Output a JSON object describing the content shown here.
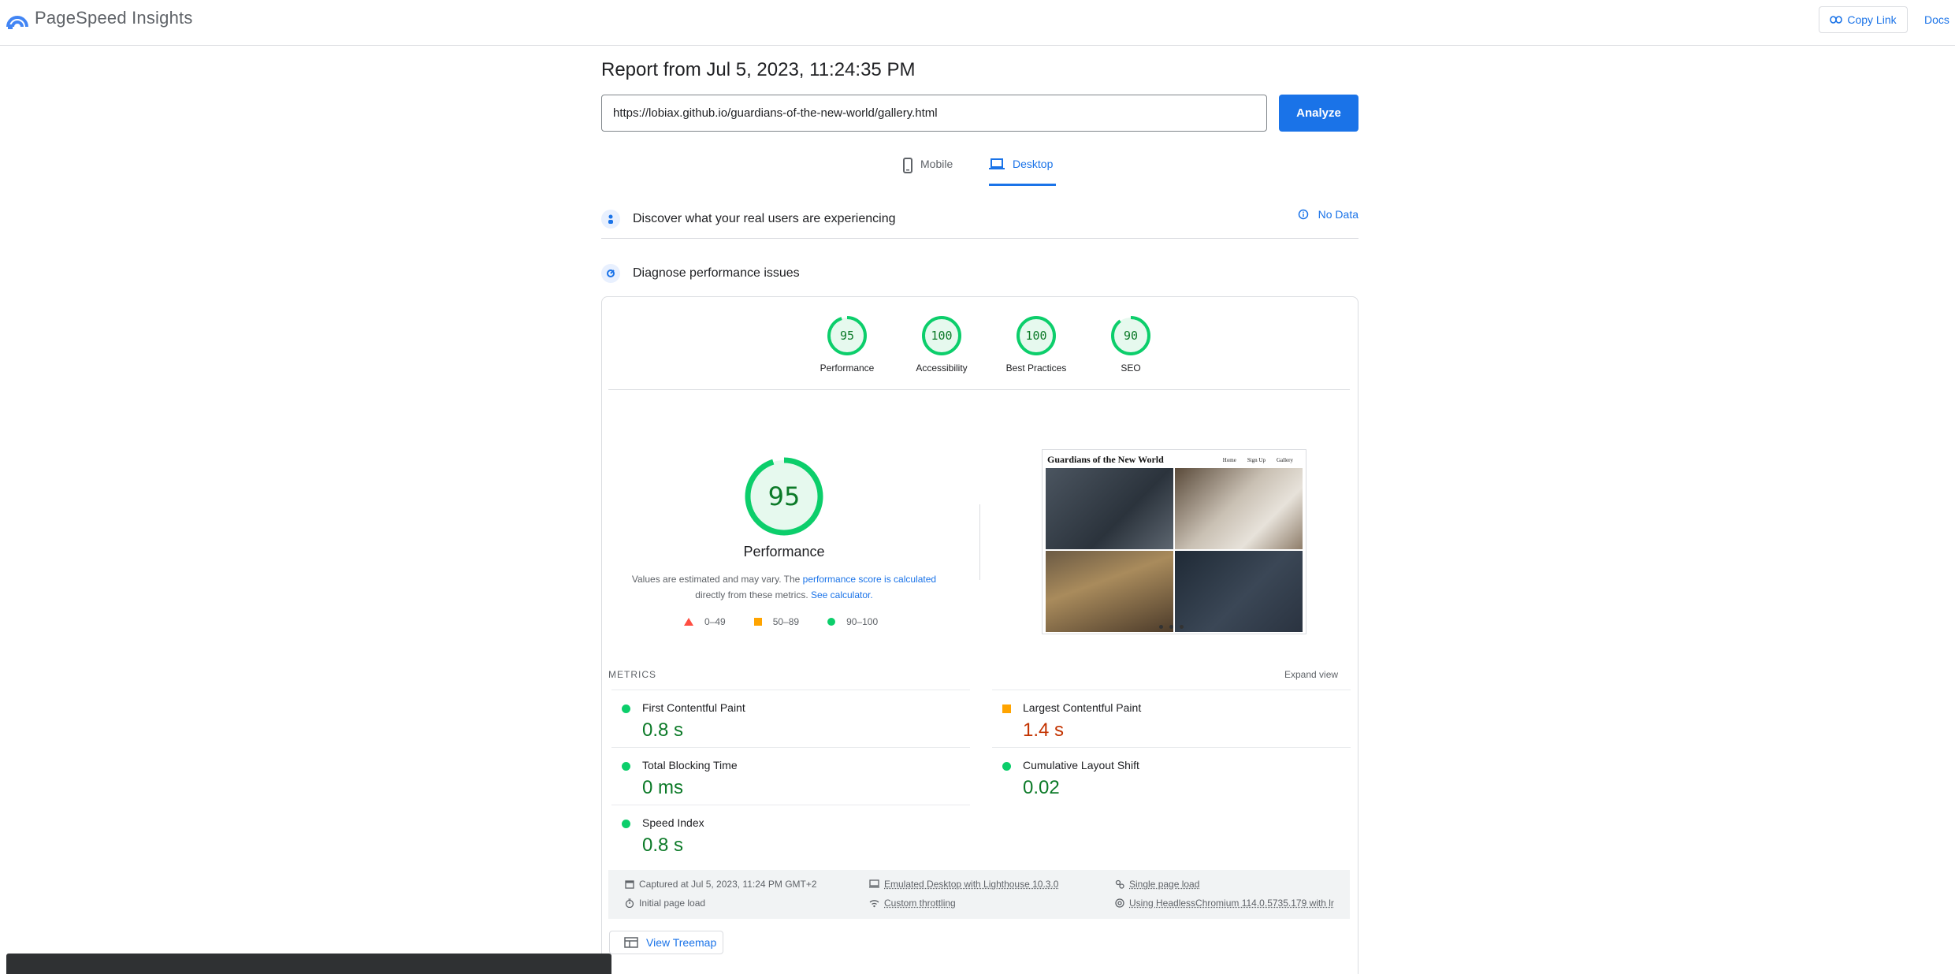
{
  "header": {
    "brand": "PageSpeed Insights",
    "copy_link": "Copy Link",
    "docs": "Docs"
  },
  "report": {
    "title": "Report from Jul 5, 2023, 11:24:35 PM",
    "url": "https://lobiax.github.io/guardians-of-the-new-world/gallery.html",
    "analyze_label": "Analyze"
  },
  "tabs": [
    {
      "label": "Mobile",
      "selected": false
    },
    {
      "label": "Desktop",
      "selected": true
    }
  ],
  "sections": {
    "discover": "Discover what your real users are experiencing",
    "no_data": "No Data",
    "diagnose": "Diagnose performance issues"
  },
  "scores": [
    {
      "label": "Performance",
      "value": "95"
    },
    {
      "label": "Accessibility",
      "value": "100"
    },
    {
      "label": "Best Practices",
      "value": "100"
    },
    {
      "label": "SEO",
      "value": "90"
    }
  ],
  "performance": {
    "score": "95",
    "title": "Performance",
    "note_prefix": "Values are estimated and may vary. The ",
    "note_link1": "performance score is calculated",
    "note_mid": " directly from these metrics. ",
    "note_link2": "See calculator."
  },
  "legend": {
    "poor": "0–49",
    "average": "50–89",
    "good": "90–100"
  },
  "thumbnail": {
    "site_title": "Guardians of the New World",
    "nav": [
      "Home",
      "Sign Up",
      "Gallery"
    ]
  },
  "metrics": {
    "heading": "METRICS",
    "expand": "Expand view",
    "items": [
      {
        "label": "First Contentful Paint",
        "value": "0.8 s",
        "rating": "good"
      },
      {
        "label": "Largest Contentful Paint",
        "value": "1.4 s",
        "rating": "average"
      },
      {
        "label": "Total Blocking Time",
        "value": "0 ms",
        "rating": "good"
      },
      {
        "label": "Cumulative Layout Shift",
        "value": "0.02",
        "rating": "good"
      },
      {
        "label": "Speed Index",
        "value": "0.8 s",
        "rating": "good"
      }
    ]
  },
  "runtime": {
    "captured": "Captured at Jul 5, 2023, 11:24 PM GMT+2",
    "initial": "Initial page load",
    "emulated": "Emulated Desktop with Lighthouse 10.3.0",
    "throttling": "Custom throttling",
    "single": "Single page load",
    "browser": "Using HeadlessChromium 114.0.5735.179 with lr"
  },
  "treemap": "View Treemap",
  "colors": {
    "good": "#0cce6b",
    "good_text": "#0c7a28",
    "average": "#ffa400",
    "poor": "#ff4e42",
    "accent": "#1a73e8"
  }
}
